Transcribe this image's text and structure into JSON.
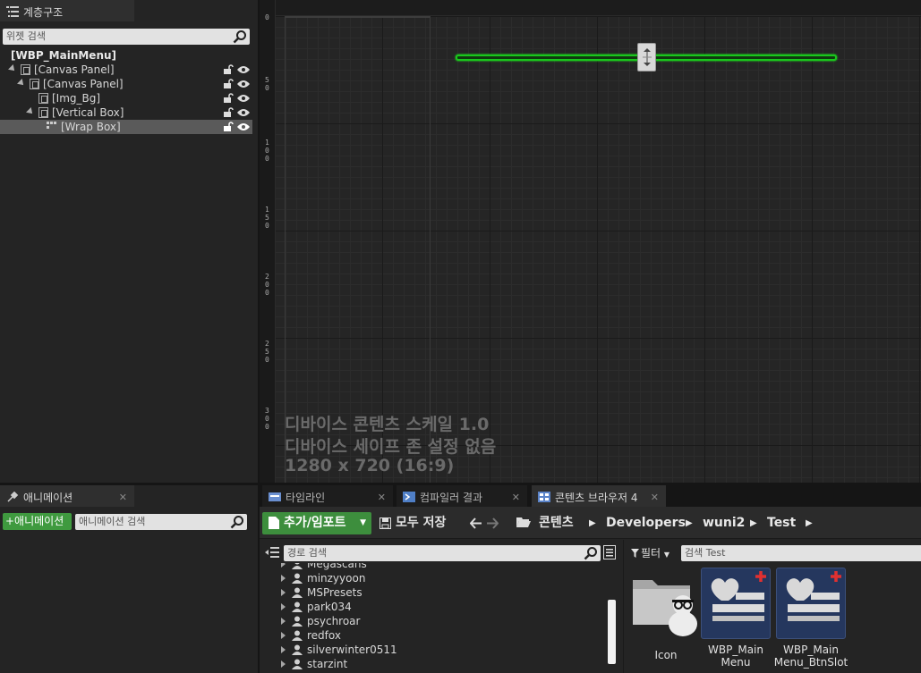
{
  "hierarchy": {
    "tab_label": "계층구조",
    "search_placeholder": "위젯 검색",
    "items": [
      {
        "label": "[WBP_MainMenu]",
        "bold": true
      },
      {
        "label": "[Canvas Panel]"
      },
      {
        "label": "[Canvas Panel]"
      },
      {
        "label": "[Img_Bg]"
      },
      {
        "label": "[Vertical Box]"
      },
      {
        "label": "[Wrap Box]",
        "selected": true
      }
    ]
  },
  "designer": {
    "ruler_ticks": [
      "0",
      "5\n0",
      "1\n0\n0",
      "1\n5\n0",
      "2\n0\n0",
      "2\n5\n0",
      "3\n0\n0"
    ],
    "device_lines": [
      "디바이스 콘텐츠 스케일 1.0",
      "디바이스 세이프 존 설정 없음",
      "1280 x 720 (16:9)"
    ],
    "accent_color": "#19c81c"
  },
  "animation": {
    "tab_label": "애니메이션",
    "add_button": "+애니메이션",
    "search_placeholder": "애니메이션 검색"
  },
  "bottom_tabs": [
    {
      "label": "타임라인",
      "active": false
    },
    {
      "label": "컴파일러 결과",
      "active": false
    },
    {
      "label": "콘텐츠 브라우저 4",
      "active": true
    }
  ],
  "content_browser": {
    "add_import": "추가/임포트",
    "save_all": "모두 저장",
    "breadcrumbs": [
      "콘텐츠",
      "Developers",
      "wuni2",
      "Test"
    ],
    "path_search_placeholder": "경로 검색",
    "filter_label": "필터",
    "asset_search_placeholder": "검색 Test",
    "folders": [
      "Megascans",
      "minzyyoon",
      "MSPresets",
      "park034",
      "psychroar",
      "redfox",
      "silverwinter0511",
      "starzint"
    ],
    "assets": [
      {
        "name": "Icon"
      },
      {
        "name": "WBP_Main Menu"
      },
      {
        "name": "WBP_Main Menu_BtnSlot"
      }
    ]
  }
}
